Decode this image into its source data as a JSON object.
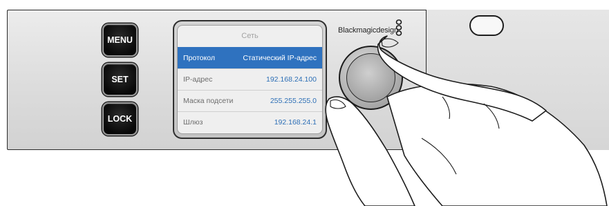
{
  "device": {
    "brand": "Blackmagicdesign"
  },
  "buttons": {
    "menu": "MENU",
    "set": "SET",
    "lock": "LOCK"
  },
  "lcd": {
    "title": "Сеть",
    "rows": [
      {
        "label": "Протокол",
        "value": "Статический IP-адрес",
        "selected": true
      },
      {
        "label": "IP-адрес",
        "value": "192.168.24.100",
        "selected": false
      },
      {
        "label": "Маска подсети",
        "value": "255.255.255.0",
        "selected": false
      },
      {
        "label": "Шлюз",
        "value": "192.168.24.1",
        "selected": false
      }
    ]
  },
  "colors": {
    "selection": "#2f72bf",
    "value_text": "#2d6fb6",
    "panel": "#dcdcdc"
  },
  "icons": {
    "brand_logo": "blackmagic-logo-icon",
    "hand": "hand-turning-knob-illustration"
  }
}
